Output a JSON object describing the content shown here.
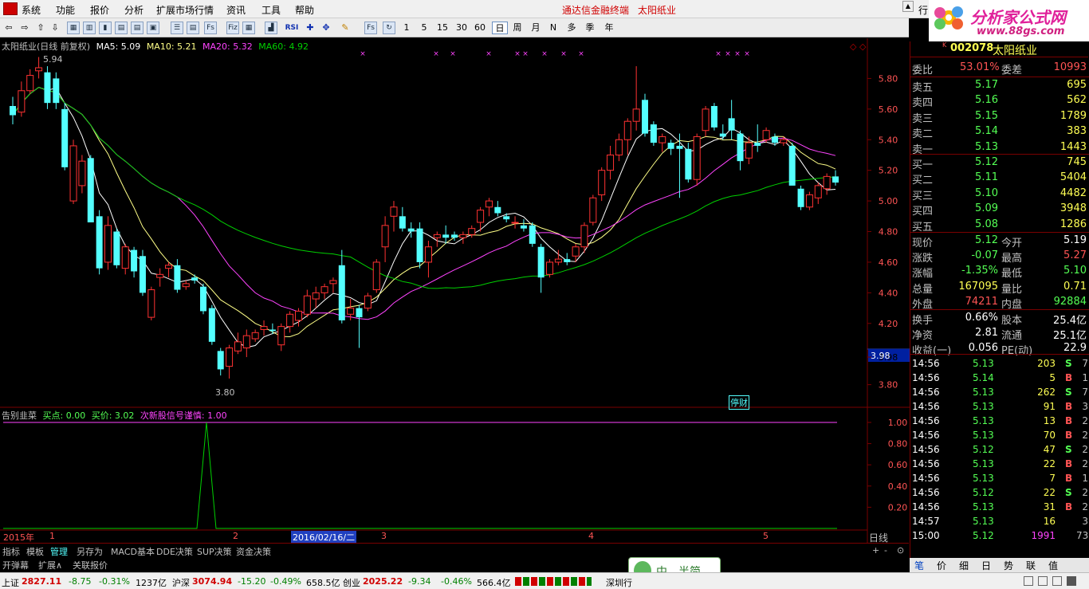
{
  "menu": {
    "items": [
      "系统",
      "功能",
      "报价",
      "分析",
      "扩展市场行情",
      "资讯",
      "工具",
      "帮助"
    ],
    "center_link": "通达信金融终端",
    "stock_name_title": "太阳纸业",
    "right_item": "行"
  },
  "logo": {
    "text": "分析家公式网",
    "url": "www.88gs.com"
  },
  "toolbar": {
    "periods": [
      "1",
      "5",
      "15",
      "30",
      "60",
      "日",
      "周",
      "月",
      "N",
      "多",
      "季",
      "年"
    ],
    "icon_labels": [
      "RSI",
      "Fs",
      "Fiz"
    ]
  },
  "chart": {
    "title": "太阳纸业(日线 前复权)",
    "ma5": "MA5: 5.09",
    "ma10": "MA10: 5.21",
    "ma20": "MA20: 5.32",
    "ma60": "MA60: 4.92",
    "y_ticks": [
      "5.80",
      "5.60",
      "5.40",
      "5.20",
      "5.00",
      "4.80",
      "4.60",
      "4.40",
      "4.20",
      "3.98",
      "3.80"
    ],
    "y_values": [
      5.8,
      5.6,
      5.4,
      5.2,
      5.0,
      4.8,
      4.6,
      4.4,
      4.2,
      3.98,
      3.8
    ],
    "high_label": "5.94",
    "low_label": "3.80",
    "note_tag": "停财",
    "current_price_tag": "3.98",
    "colors": {
      "up": "#ff3232",
      "down": "#54ffff",
      "ma5": "#ffffff",
      "ma10": "#ffff88",
      "ma20": "#ff44ff",
      "ma60": "#00d000"
    }
  },
  "chart_data": {
    "type": "candlestick",
    "ylim": [
      3.72,
      6.0
    ],
    "candles": [
      [
        5.62,
        5.68,
        5.5,
        5.56
      ],
      [
        5.58,
        5.78,
        5.55,
        5.72
      ],
      [
        5.72,
        5.86,
        5.7,
        5.82
      ],
      [
        5.85,
        5.94,
        5.8,
        5.87
      ],
      [
        5.84,
        5.88,
        5.6,
        5.64
      ],
      [
        5.8,
        5.84,
        5.6,
        5.64
      ],
      [
        5.6,
        5.64,
        5.2,
        5.22
      ],
      [
        5.0,
        5.4,
        4.98,
        5.36
      ],
      [
        5.1,
        5.3,
        5.05,
        5.26
      ],
      [
        5.28,
        5.3,
        4.86,
        4.86
      ],
      [
        4.9,
        4.94,
        4.52,
        4.56
      ],
      [
        4.6,
        4.9,
        4.55,
        4.84
      ],
      [
        4.8,
        4.82,
        4.56,
        4.58
      ],
      [
        4.56,
        4.72,
        4.52,
        4.7
      ],
      [
        4.68,
        4.7,
        4.5,
        4.54
      ],
      [
        4.64,
        4.68,
        4.38,
        4.4
      ],
      [
        4.24,
        4.44,
        4.22,
        4.42
      ],
      [
        4.5,
        4.56,
        4.44,
        4.52
      ],
      [
        4.56,
        4.6,
        4.5,
        4.58
      ],
      [
        4.58,
        4.62,
        4.4,
        4.42
      ],
      [
        4.44,
        4.48,
        4.42,
        4.46
      ],
      [
        4.5,
        4.52,
        4.46,
        4.48
      ],
      [
        4.44,
        4.46,
        4.26,
        4.28
      ],
      [
        4.3,
        4.32,
        4.06,
        4.08
      ],
      [
        4.02,
        4.04,
        3.86,
        3.9
      ],
      [
        3.92,
        4.06,
        3.84,
        4.04
      ],
      [
        4.02,
        4.14,
        4.0,
        4.08
      ],
      [
        4.04,
        4.16,
        3.98,
        4.12
      ],
      [
        4.1,
        4.16,
        4.08,
        4.14
      ],
      [
        4.16,
        4.22,
        4.12,
        4.18
      ],
      [
        4.16,
        4.2,
        4.13,
        4.15
      ],
      [
        4.06,
        4.2,
        4.02,
        4.18
      ],
      [
        4.18,
        4.28,
        4.14,
        4.26
      ],
      [
        4.22,
        4.3,
        4.18,
        4.28
      ],
      [
        4.26,
        4.42,
        4.24,
        4.38
      ],
      [
        4.36,
        4.44,
        4.3,
        4.4
      ],
      [
        4.4,
        4.46,
        4.36,
        4.44
      ],
      [
        4.46,
        4.5,
        4.4,
        4.48
      ],
      [
        4.58,
        4.68,
        4.2,
        4.22
      ],
      [
        4.26,
        4.36,
        4.22,
        4.3
      ],
      [
        4.3,
        4.32,
        4.04,
        4.24
      ],
      [
        4.3,
        4.4,
        4.28,
        4.38
      ],
      [
        4.42,
        4.62,
        4.4,
        4.6
      ],
      [
        4.7,
        4.9,
        4.6,
        4.84
      ],
      [
        4.9,
        5.0,
        4.8,
        4.96
      ],
      [
        4.9,
        4.96,
        4.8,
        4.82
      ],
      [
        4.82,
        4.86,
        4.76,
        4.8
      ],
      [
        4.82,
        4.86,
        4.56,
        4.6
      ],
      [
        4.6,
        4.74,
        4.5,
        4.7
      ],
      [
        4.76,
        4.8,
        4.7,
        4.78
      ],
      [
        4.78,
        4.84,
        4.72,
        4.76
      ],
      [
        4.78,
        4.8,
        4.74,
        4.76
      ],
      [
        4.76,
        4.8,
        4.72,
        4.78
      ],
      [
        4.78,
        4.84,
        4.76,
        4.82
      ],
      [
        4.86,
        4.96,
        4.8,
        4.94
      ],
      [
        4.96,
        5.02,
        4.9,
        5.0
      ],
      [
        4.96,
        5.0,
        4.9,
        4.92
      ],
      [
        4.9,
        4.92,
        4.86,
        4.88
      ],
      [
        4.86,
        4.9,
        4.82,
        4.86
      ],
      [
        4.84,
        4.88,
        4.8,
        4.82
      ],
      [
        4.84,
        4.86,
        4.7,
        4.72
      ],
      [
        4.7,
        4.72,
        4.4,
        4.5
      ],
      [
        4.52,
        4.62,
        4.5,
        4.6
      ],
      [
        4.6,
        4.68,
        4.58,
        4.62
      ],
      [
        4.62,
        4.66,
        4.58,
        4.6
      ],
      [
        4.64,
        4.72,
        4.6,
        4.7
      ],
      [
        4.7,
        4.86,
        4.66,
        4.84
      ],
      [
        4.86,
        5.04,
        4.84,
        5.02
      ],
      [
        5.04,
        5.22,
        5.0,
        5.2
      ],
      [
        5.2,
        5.36,
        5.14,
        5.3
      ],
      [
        5.3,
        5.44,
        5.26,
        5.4
      ],
      [
        5.4,
        5.54,
        5.3,
        5.52
      ],
      [
        5.52,
        5.88,
        5.46,
        5.6
      ],
      [
        5.66,
        5.7,
        5.42,
        5.44
      ],
      [
        5.5,
        5.52,
        5.36,
        5.38
      ],
      [
        5.38,
        5.44,
        5.32,
        5.42
      ],
      [
        5.38,
        5.4,
        5.3,
        5.34
      ],
      [
        5.36,
        5.44,
        5.02,
        5.34
      ],
      [
        5.34,
        5.38,
        5.12,
        5.14
      ],
      [
        5.14,
        5.44,
        5.1,
        5.42
      ],
      [
        5.46,
        5.62,
        5.42,
        5.6
      ],
      [
        5.62,
        5.64,
        5.46,
        5.48
      ],
      [
        5.44,
        5.5,
        5.4,
        5.42
      ],
      [
        5.54,
        5.66,
        5.4,
        5.46
      ],
      [
        5.44,
        5.46,
        5.2,
        5.26
      ],
      [
        5.28,
        5.42,
        5.24,
        5.38
      ],
      [
        5.38,
        5.5,
        5.32,
        5.36
      ],
      [
        5.4,
        5.48,
        5.38,
        5.46
      ],
      [
        5.42,
        5.44,
        5.36,
        5.38
      ],
      [
        5.38,
        5.42,
        5.36,
        5.4
      ],
      [
        5.36,
        5.38,
        5.14,
        5.1
      ],
      [
        5.08,
        5.1,
        4.94,
        4.96
      ],
      [
        4.96,
        5.06,
        4.94,
        5.04
      ],
      [
        5.02,
        5.12,
        4.98,
        5.1
      ],
      [
        5.08,
        5.18,
        5.04,
        5.16
      ],
      [
        5.16,
        5.2,
        5.1,
        5.12
      ]
    ]
  },
  "indicator": {
    "name": "告别韭菜",
    "buy_point": "买点: 0.00",
    "buy_price": "买价: 3.02",
    "signal": "次新股信号谨慎: 1.00",
    "y_ticks": [
      "1.00",
      "0.80",
      "0.60",
      "0.40",
      "0.20"
    ]
  },
  "datebar": {
    "year": "2015年",
    "m1": "1",
    "m2": "2",
    "date": "2016/02/16/二",
    "m3": "3",
    "m4": "4",
    "m5": "5",
    "period": "日线"
  },
  "right_panel": {
    "code": "002078",
    "name": "太阳纸业",
    "weibi_label": "委比",
    "weibi": "53.01%",
    "weicha_label": "委差",
    "weicha": "10993",
    "asks": [
      {
        "label": "卖五",
        "price": "5.17",
        "vol": "695"
      },
      {
        "label": "卖四",
        "price": "5.16",
        "vol": "562"
      },
      {
        "label": "卖三",
        "price": "5.15",
        "vol": "1789"
      },
      {
        "label": "卖二",
        "price": "5.14",
        "vol": "383"
      },
      {
        "label": "卖一",
        "price": "5.13",
        "vol": "1443"
      }
    ],
    "bids": [
      {
        "label": "买一",
        "price": "5.12",
        "vol": "745"
      },
      {
        "label": "买二",
        "price": "5.11",
        "vol": "5404"
      },
      {
        "label": "买三",
        "price": "5.10",
        "vol": "4482"
      },
      {
        "label": "买四",
        "price": "5.09",
        "vol": "3948"
      },
      {
        "label": "买五",
        "price": "5.08",
        "vol": "1286"
      }
    ],
    "quote": [
      {
        "l1": "现价",
        "v1": "5.12",
        "l2": "今开",
        "v2": "5.19",
        "c1": "#54ff54",
        "c2": "#ffffff"
      },
      {
        "l1": "涨跌",
        "v1": "-0.07",
        "l2": "最高",
        "v2": "5.27",
        "c1": "#54ff54",
        "c2": "#ff5454"
      },
      {
        "l1": "涨幅",
        "v1": "-1.35%",
        "l2": "最低",
        "v2": "5.10",
        "c1": "#54ff54",
        "c2": "#54ff54"
      },
      {
        "l1": "总量",
        "v1": "167095",
        "l2": "量比",
        "v2": "0.71",
        "c1": "#ffff54",
        "c2": "#ffff54"
      },
      {
        "l1": "外盘",
        "v1": "74211",
        "l2": "内盘",
        "v2": "92884",
        "c1": "#ff5454",
        "c2": "#54ff54"
      }
    ],
    "fin": [
      {
        "l1": "换手",
        "v1": "0.66%",
        "l2": "股本",
        "v2": "25.4亿"
      },
      {
        "l1": "净资",
        "v1": "2.81",
        "l2": "流通",
        "v2": "25.1亿"
      },
      {
        "l1": "收益(一)",
        "v1": "0.056",
        "l2": "PE(动)",
        "v2": "22.9"
      }
    ],
    "ticks": [
      {
        "t": "14:56",
        "p": "5.13",
        "v": "203",
        "d": "S",
        "n": "7"
      },
      {
        "t": "14:56",
        "p": "5.14",
        "v": "5",
        "d": "B",
        "n": "1"
      },
      {
        "t": "14:56",
        "p": "5.13",
        "v": "262",
        "d": "S",
        "n": "7"
      },
      {
        "t": "14:56",
        "p": "5.13",
        "v": "91",
        "d": "B",
        "n": "3"
      },
      {
        "t": "14:56",
        "p": "5.13",
        "v": "13",
        "d": "B",
        "n": "2"
      },
      {
        "t": "14:56",
        "p": "5.13",
        "v": "70",
        "d": "B",
        "n": "2"
      },
      {
        "t": "14:56",
        "p": "5.12",
        "v": "47",
        "d": "S",
        "n": "2"
      },
      {
        "t": "14:56",
        "p": "5.13",
        "v": "22",
        "d": "B",
        "n": "2"
      },
      {
        "t": "14:56",
        "p": "5.13",
        "v": "7",
        "d": "B",
        "n": "1"
      },
      {
        "t": "14:56",
        "p": "5.12",
        "v": "22",
        "d": "S",
        "n": "2"
      },
      {
        "t": "14:56",
        "p": "5.13",
        "v": "31",
        "d": "B",
        "n": "2"
      },
      {
        "t": "14:57",
        "p": "5.13",
        "v": "16",
        "d": "",
        "n": "3"
      },
      {
        "t": "15:00",
        "p": "5.12",
        "v": "1991",
        "d": "",
        "n": "73"
      }
    ],
    "tabs": [
      "笔",
      "价",
      "细",
      "日",
      "势",
      "联",
      "值"
    ]
  },
  "bottom_tabs": [
    "指标",
    "模板",
    "管理",
    "另存为",
    "MACD基本",
    "DDE决策",
    "SUP决策",
    "资金决策"
  ],
  "bottom_tabs2": [
    "开弹幕",
    "扩展∧",
    "关联报价"
  ],
  "banner": "中。半简",
  "status": {
    "sh_label": "上证",
    "sh": "2827.11",
    "sh_chg": "-8.75",
    "sh_pct": "-0.31%",
    "sh_amt": "1237亿",
    "hs_label": "沪深",
    "hs": "3074.94",
    "hs_chg": "-15.20",
    "hs_pct": "-0.49%",
    "hs_amt": "658.5亿",
    "cy_label": "创业",
    "cy": "2025.22",
    "cy_chg": "-9.34",
    "cy_pct": "-0.46%",
    "cy_amt": "566.4亿",
    "sz_label": "深圳行"
  }
}
